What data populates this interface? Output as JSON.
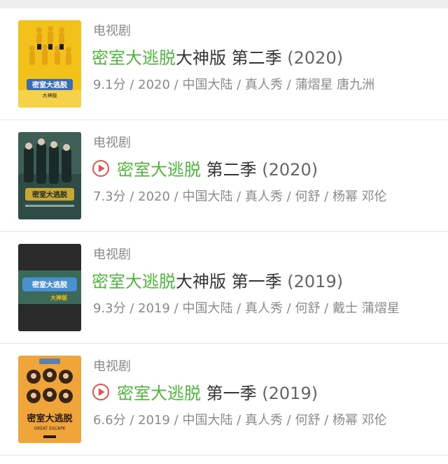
{
  "results": [
    {
      "category": "电视剧",
      "title_highlight": "密室大逃脱",
      "title_rest": "大神版 第二季",
      "title_year": "(2020)",
      "has_play_icon": false,
      "meta": "9.1分 / 2020 / 中国大陆 / 真人秀 / 蒲熠星 唐九洲",
      "poster_logo_text": "密室大逃脱",
      "poster_sub_text": "大神版"
    },
    {
      "category": "电视剧",
      "title_highlight": "密室大逃脱",
      "title_rest": " 第二季",
      "title_year": "(2020)",
      "has_play_icon": true,
      "meta": "7.3分 / 2020 / 中国大陆 / 真人秀 / 何舒 / 杨幂 邓伦",
      "poster_logo_text": "密室大逃脱",
      "poster_sub_text": ""
    },
    {
      "category": "电视剧",
      "title_highlight": "密室大逃脱",
      "title_rest": "大神版 第一季",
      "title_year": "(2019)",
      "has_play_icon": false,
      "meta": "9.3分 / 2019 / 中国大陆 / 真人秀 / 何舒 / 戴士 蒲熠星",
      "poster_logo_text": "密室大逃脱",
      "poster_sub_text": "大神版"
    },
    {
      "category": "电视剧",
      "title_highlight": "密室大逃脱",
      "title_rest": " 第一季",
      "title_year": "(2019)",
      "has_play_icon": true,
      "meta": "6.6分 / 2019 / 中国大陆 / 真人秀 / 何舒 / 杨幂 邓伦",
      "poster_logo_text": "密室大逃脱",
      "poster_sub_text": "GREAT ESCAPE"
    }
  ],
  "colors": {
    "highlight": "#4fb83c",
    "play_icon": "#e8504a",
    "meta": "#8a8a8a"
  },
  "icons": {
    "play": "play-circle-icon"
  }
}
